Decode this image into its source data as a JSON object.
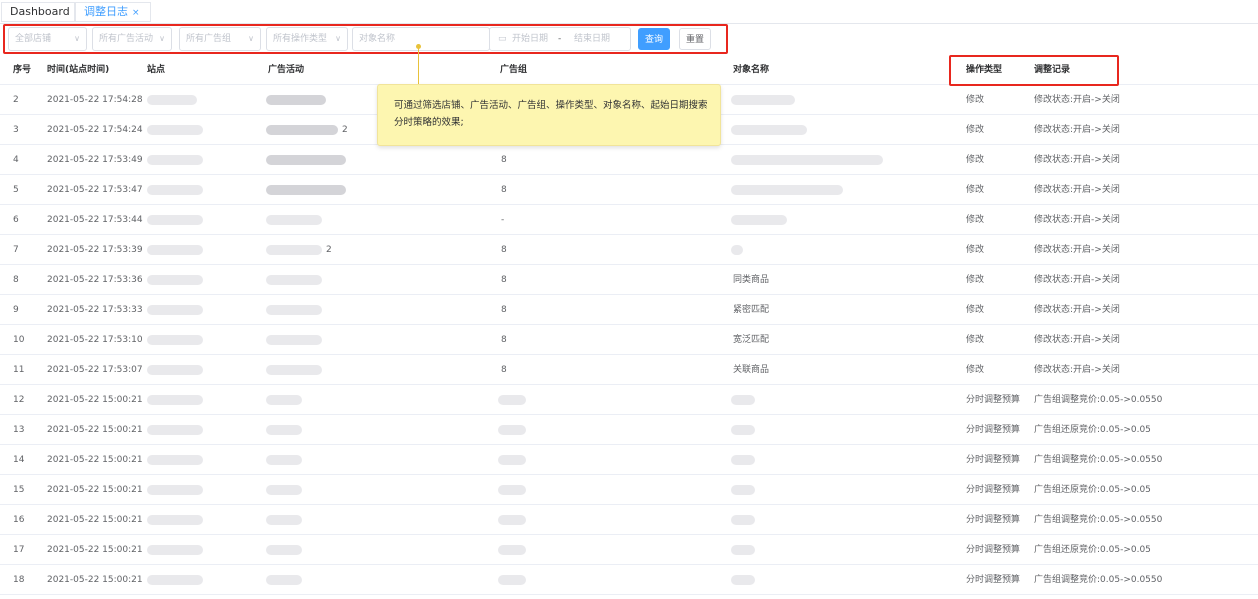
{
  "tabs": [
    {
      "label": "Dashboard",
      "active": false
    },
    {
      "label": "调整日志",
      "active": true,
      "close": "×"
    }
  ],
  "filters": {
    "store": "全部店铺",
    "campaign": "所有广告活动",
    "adgroup": "所有广告组",
    "op_type": "所有操作类型",
    "object_name_placeholder": "对象名称",
    "date_start_placeholder": "开始日期",
    "date_sep": "-",
    "date_end_placeholder": "结束日期",
    "query_label": "查询",
    "reset_label": "重置"
  },
  "tooltip": {
    "text": "可通过筛选店铺、广告活动、广告组、操作类型、对象名称、起始日期搜索分时策略的效果;"
  },
  "table": {
    "columns": [
      "序号",
      "时间(站点时间)",
      "站点",
      "广告活动",
      "广告组",
      "对象名称",
      "操作类型",
      "调整记录"
    ],
    "rows": [
      {
        "no": "2",
        "time": "2021-05-22 17:54:28",
        "campaign_suffix": "",
        "adgroup": "",
        "object": "",
        "op": "修改",
        "record": "修改状态:开启->关闭"
      },
      {
        "no": "3",
        "time": "2021-05-22 17:54:24",
        "campaign_suffix": "2",
        "adgroup": "",
        "object": "",
        "op": "修改",
        "record": "修改状态:开启->关闭"
      },
      {
        "no": "4",
        "time": "2021-05-22 17:53:49",
        "campaign_suffix": "",
        "adgroup": "8",
        "object": "",
        "op": "修改",
        "record": "修改状态:开启->关闭"
      },
      {
        "no": "5",
        "time": "2021-05-22 17:53:47",
        "campaign_suffix": "",
        "adgroup": "8",
        "object": "",
        "op": "修改",
        "record": "修改状态:开启->关闭"
      },
      {
        "no": "6",
        "time": "2021-05-22 17:53:44",
        "campaign_suffix": "",
        "adgroup": "-",
        "object": "",
        "op": "修改",
        "record": "修改状态:开启->关闭"
      },
      {
        "no": "7",
        "time": "2021-05-22 17:53:39",
        "campaign_suffix": "2",
        "adgroup": "8",
        "object": "",
        "op": "修改",
        "record": "修改状态:开启->关闭"
      },
      {
        "no": "8",
        "time": "2021-05-22 17:53:36",
        "campaign_suffix": "",
        "adgroup": "8",
        "object": "同类商品",
        "op": "修改",
        "record": "修改状态:开启->关闭"
      },
      {
        "no": "9",
        "time": "2021-05-22 17:53:33",
        "campaign_suffix": "",
        "adgroup": "8",
        "object": "紧密匹配",
        "op": "修改",
        "record": "修改状态:开启->关闭"
      },
      {
        "no": "10",
        "time": "2021-05-22 17:53:10",
        "campaign_suffix": "",
        "adgroup": "8",
        "object": "宽泛匹配",
        "op": "修改",
        "record": "修改状态:开启->关闭"
      },
      {
        "no": "11",
        "time": "2021-05-22 17:53:07",
        "campaign_suffix": "",
        "adgroup": "8",
        "object": "关联商品",
        "op": "修改",
        "record": "修改状态:开启->关闭"
      },
      {
        "no": "12",
        "time": "2021-05-22 15:00:21",
        "campaign_suffix": "",
        "adgroup": "",
        "object": "",
        "op": "分时调整预算",
        "record": "广告组调整竞价:0.05->0.0550"
      },
      {
        "no": "13",
        "time": "2021-05-22 15:00:21",
        "campaign_suffix": "",
        "adgroup": "",
        "object": "",
        "op": "分时调整预算",
        "record": "广告组还原竞价:0.05->0.05"
      },
      {
        "no": "14",
        "time": "2021-05-22 15:00:21",
        "campaign_suffix": "",
        "adgroup": "",
        "object": "",
        "op": "分时调整预算",
        "record": "广告组调整竞价:0.05->0.0550"
      },
      {
        "no": "15",
        "time": "2021-05-22 15:00:21",
        "campaign_suffix": "",
        "adgroup": "",
        "object": "",
        "op": "分时调整预算",
        "record": "广告组还原竞价:0.05->0.05"
      },
      {
        "no": "16",
        "time": "2021-05-22 15:00:21",
        "campaign_suffix": "",
        "adgroup": "",
        "object": "",
        "op": "分时调整预算",
        "record": "广告组调整竞价:0.05->0.0550"
      },
      {
        "no": "17",
        "time": "2021-05-22 15:00:21",
        "campaign_suffix": "",
        "adgroup": "",
        "object": "",
        "op": "分时调整预算",
        "record": "广告组还原竞价:0.05->0.05"
      },
      {
        "no": "18",
        "time": "2021-05-22 15:00:21",
        "campaign_suffix": "",
        "adgroup": "",
        "object": "",
        "op": "分时调整预算",
        "record": "广告组调整竞价:0.05->0.0550"
      }
    ]
  },
  "colors": {
    "primary": "#409eff",
    "highlight": "#e8271e",
    "tooltip_bg": "#fdf6b0"
  }
}
